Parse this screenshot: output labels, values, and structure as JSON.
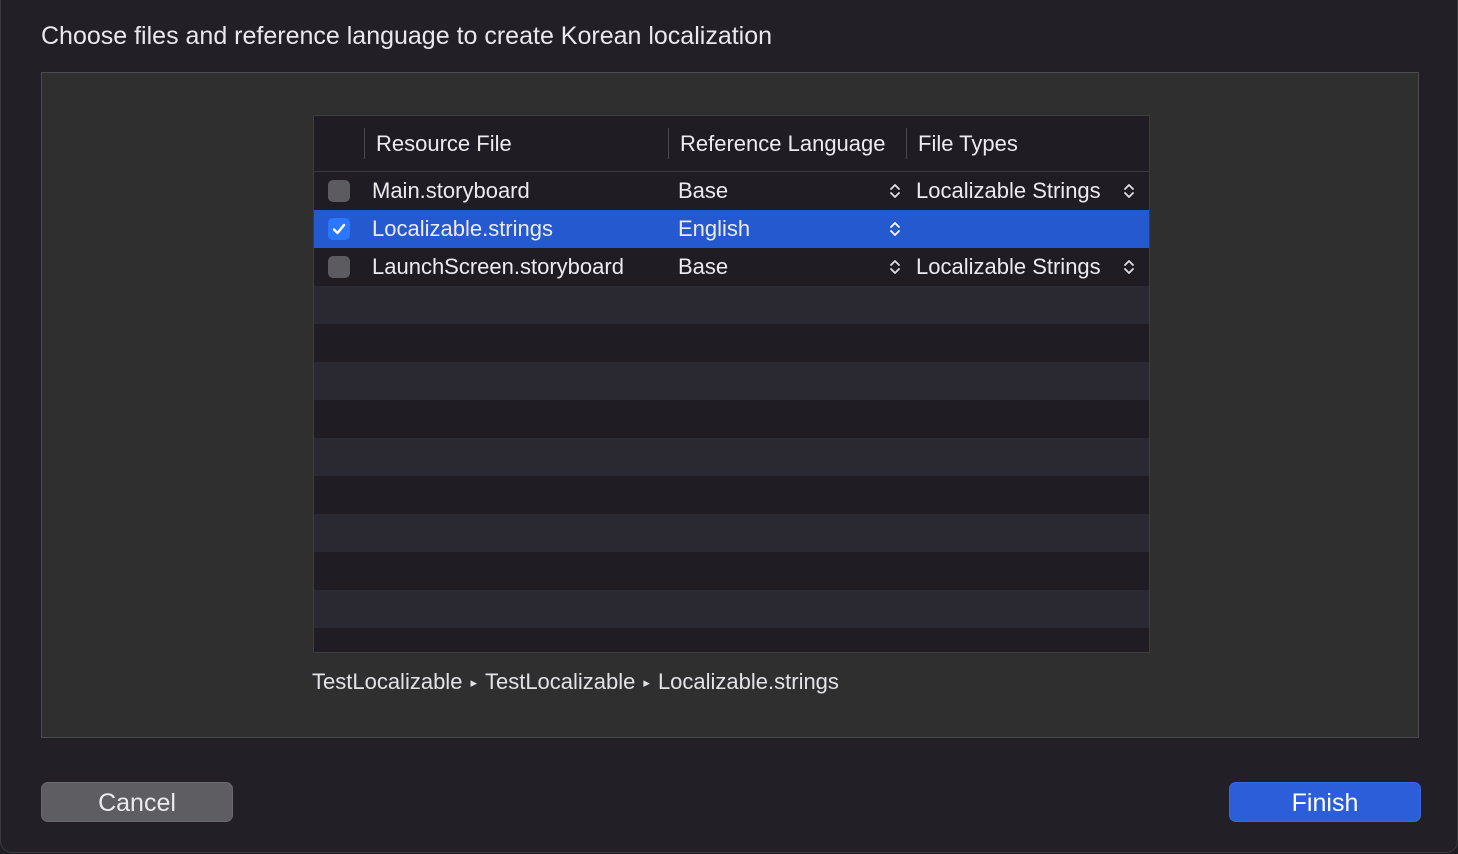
{
  "dialog": {
    "title": "Choose files and reference language to create Korean localization"
  },
  "table": {
    "columns": [
      "Resource File",
      "Reference Language",
      "File Types"
    ],
    "rows": [
      {
        "checked": false,
        "file": "Main.storyboard",
        "language": "Base",
        "file_type": "Localizable Strings",
        "selected": false
      },
      {
        "checked": true,
        "file": "Localizable.strings",
        "language": "English",
        "file_type": "",
        "selected": true
      },
      {
        "checked": false,
        "file": "LaunchScreen.storyboard",
        "language": "Base",
        "file_type": "Localizable Strings",
        "selected": false
      }
    ]
  },
  "path_bar": {
    "segments": [
      "TestLocalizable",
      "TestLocalizable",
      "Localizable.strings"
    ],
    "separator_icon": "triangle-right-icon"
  },
  "buttons": {
    "cancel_label": "Cancel",
    "finish_label": "Finish"
  },
  "colors": {
    "selection": "#2459cf",
    "accent": "#2c5ed9"
  }
}
